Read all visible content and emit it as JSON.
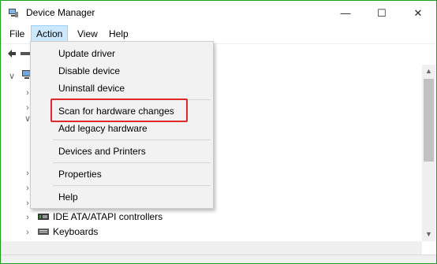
{
  "window": {
    "title": "Device Manager",
    "minimize_glyph": "—",
    "maximize_glyph": "☐",
    "close_glyph": "✕"
  },
  "menubar": [
    {
      "id": "file",
      "label": "File"
    },
    {
      "id": "action",
      "label": "Action"
    },
    {
      "id": "view",
      "label": "View"
    },
    {
      "id": "help",
      "label": "Help"
    }
  ],
  "action_menu": [
    "Update driver",
    "Disable device",
    "Uninstall device",
    "Scan for hardware changes",
    "Add legacy hardware",
    "Devices and Printers",
    "Properties",
    "Help"
  ],
  "highlighted_item": "Scan for hardware changes",
  "tree": [
    {
      "label": "IDE ATA/ATAPI controllers",
      "icon": "ide-controller-icon"
    },
    {
      "label": "Keyboards",
      "icon": "keyboard-icon"
    }
  ],
  "colors": {
    "window_border": "#18a018",
    "highlight_box": "#e0282d",
    "menu_active": "#cce8ff"
  }
}
